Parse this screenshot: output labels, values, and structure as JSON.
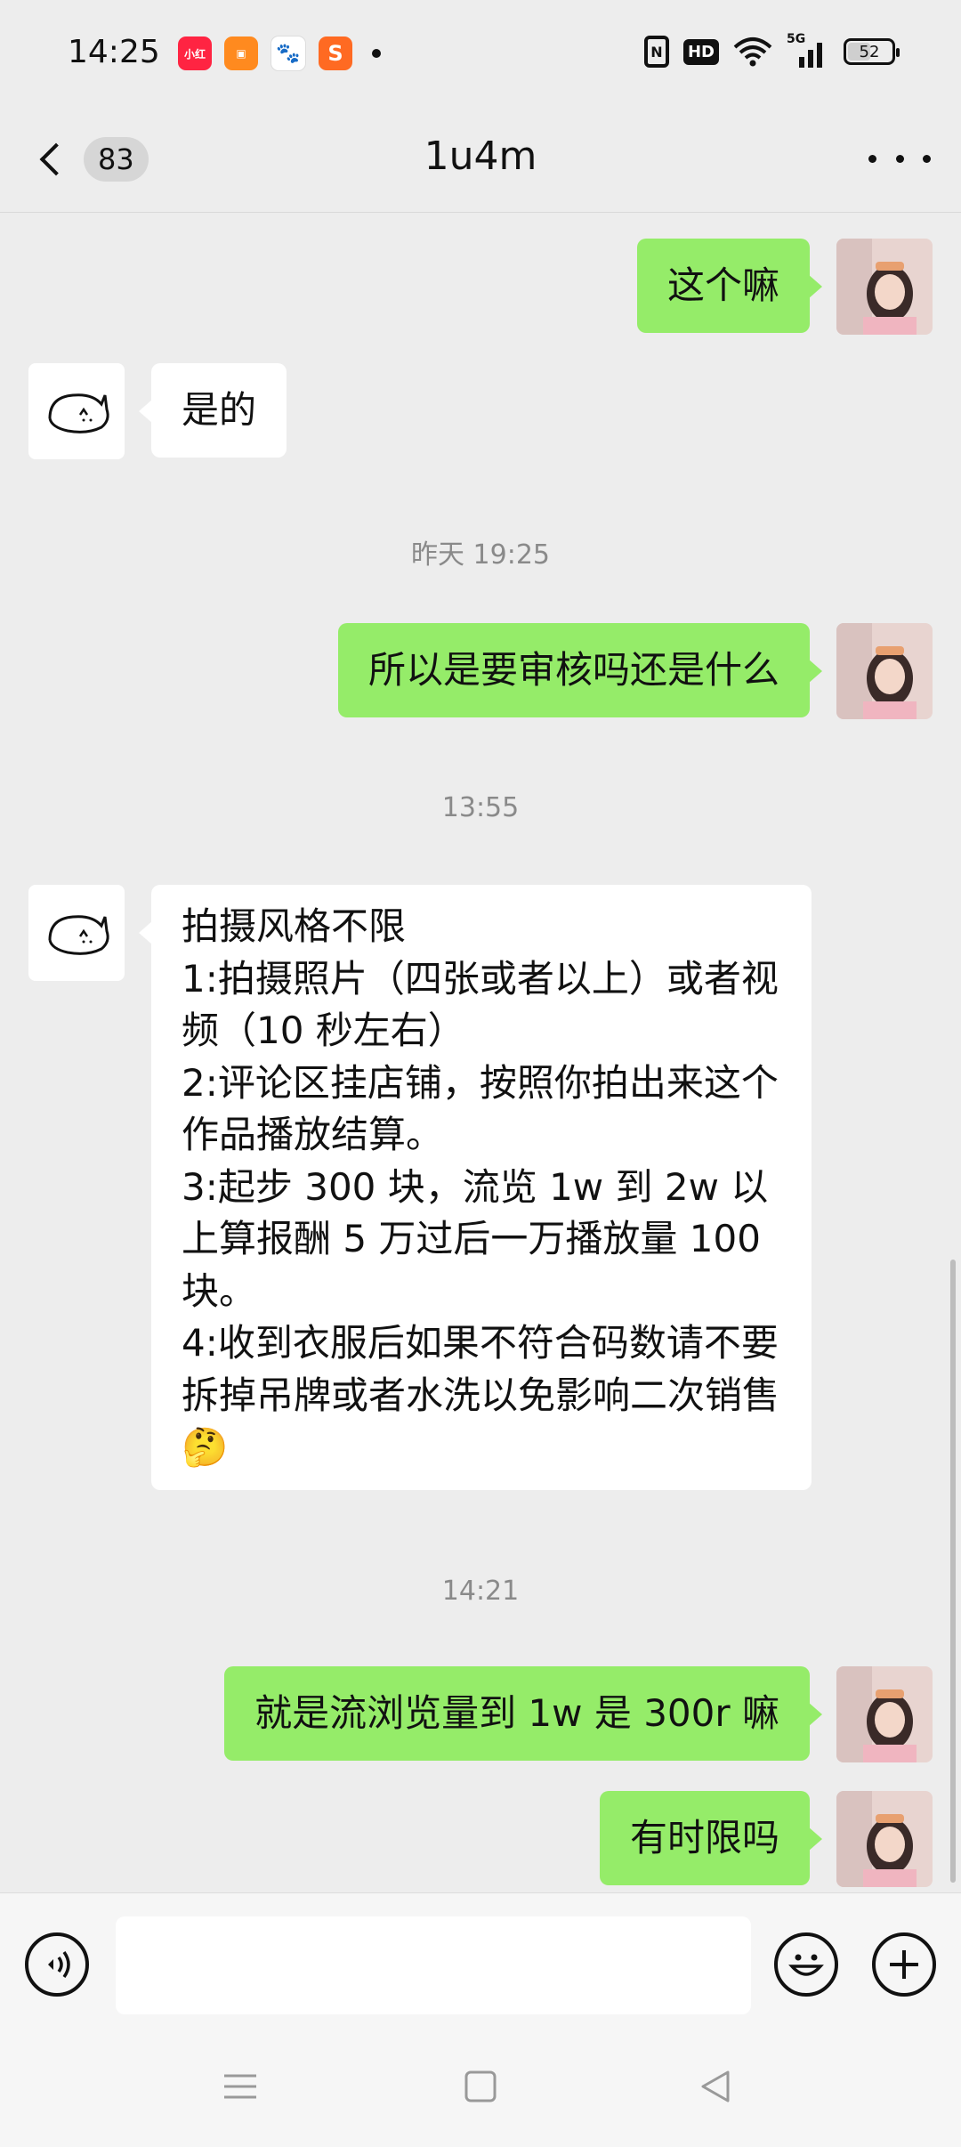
{
  "status_bar": {
    "time": "14:25",
    "app_icons": [
      "xiaohongshu-icon",
      "app-orange-icon",
      "baidu-icon",
      "sogou-icon"
    ],
    "signal": "5G",
    "hd": "HD",
    "battery": "52",
    "battery_level": 0.52
  },
  "header": {
    "back_count": "83",
    "title": "1u4m"
  },
  "messages": [
    {
      "side": "me",
      "text": "这个嘛"
    },
    {
      "side": "other",
      "text": "是的"
    },
    {
      "timestamp": "昨天 19:25"
    },
    {
      "side": "me",
      "text": "所以是要审核吗还是什么"
    },
    {
      "timestamp": "13:55"
    },
    {
      "side": "other",
      "text": "拍摄风格不限\n1:拍摄照片（四张或者以上）或者视频（10 秒左右）\n2:评论区挂店铺，按照你拍出来这个作品播放结算。\n3:起步 300 块，流览 1w 到 2w 以上算报酬 5 万过后一万播放量 100 块。\n4:收到衣服后如果不符合码数请不要拆掉吊牌或者水洗以免影响二次销售🤔"
    },
    {
      "timestamp": "14:21"
    },
    {
      "side": "me",
      "text": "就是流浏览量到 1w 是 300r 嘛"
    },
    {
      "side": "me",
      "text": "有时限吗"
    }
  ],
  "colors": {
    "bubble_me": "#95ec69",
    "bubble_other": "#ffffff",
    "background": "#ededed"
  }
}
